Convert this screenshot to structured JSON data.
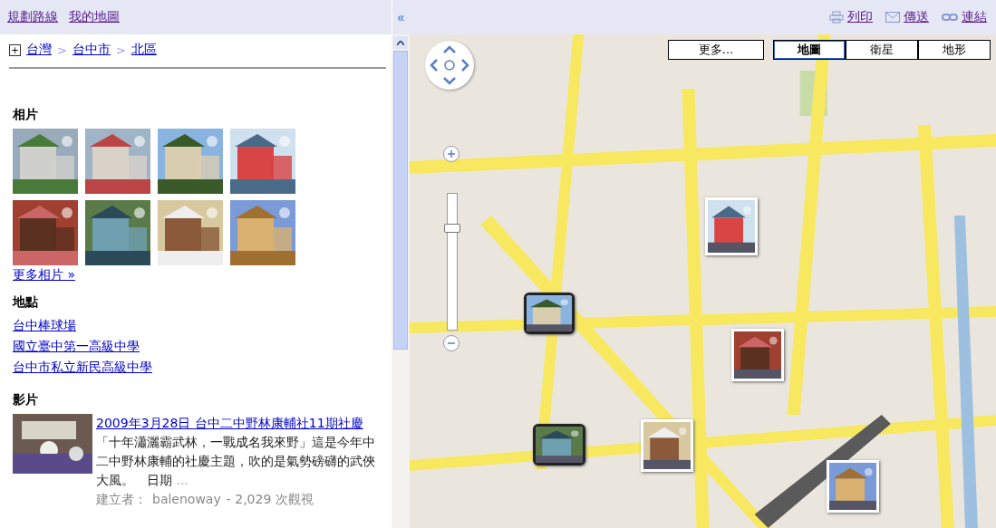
{
  "top_links": [
    "規劃路線",
    "我的地圖"
  ],
  "collapse": "«",
  "actions": [
    {
      "kind": "print",
      "label": "列印"
    },
    {
      "kind": "mail",
      "label": "傳送"
    },
    {
      "kind": "link",
      "label": "連結"
    }
  ],
  "breadcrumb": {
    "expand": "+",
    "items": [
      "台灣",
      "台中市",
      "北區"
    ],
    "separator": ">"
  },
  "photos": {
    "heading": "相片",
    "more": "更多相片 »"
  },
  "places": {
    "heading": "地點",
    "items": [
      "台中棒球場",
      "國立臺中第一高級中學",
      "台中市私立新民高級中學"
    ]
  },
  "videos": {
    "heading": "影片",
    "items": [
      {
        "title": "2009年3月28日 台中二中野林康輔社11期社慶",
        "description": "「十年瀟灑霸武林，一戰成名我來野」這是今年中二中野林康輔的社慶主題，吹的是氣勢磅礴的武俠大風。　日期",
        "ellipsis": "...",
        "author_label": "建立者：",
        "author": "balenoway",
        "views": "- 2,029 次觀視"
      }
    ]
  },
  "map": {
    "more": "更多...",
    "types": [
      {
        "label": "地圖",
        "selected": true
      },
      {
        "label": "衛星",
        "selected": false
      },
      {
        "label": "地形",
        "selected": false
      }
    ],
    "zoom": {
      "level": 0.77
    }
  }
}
